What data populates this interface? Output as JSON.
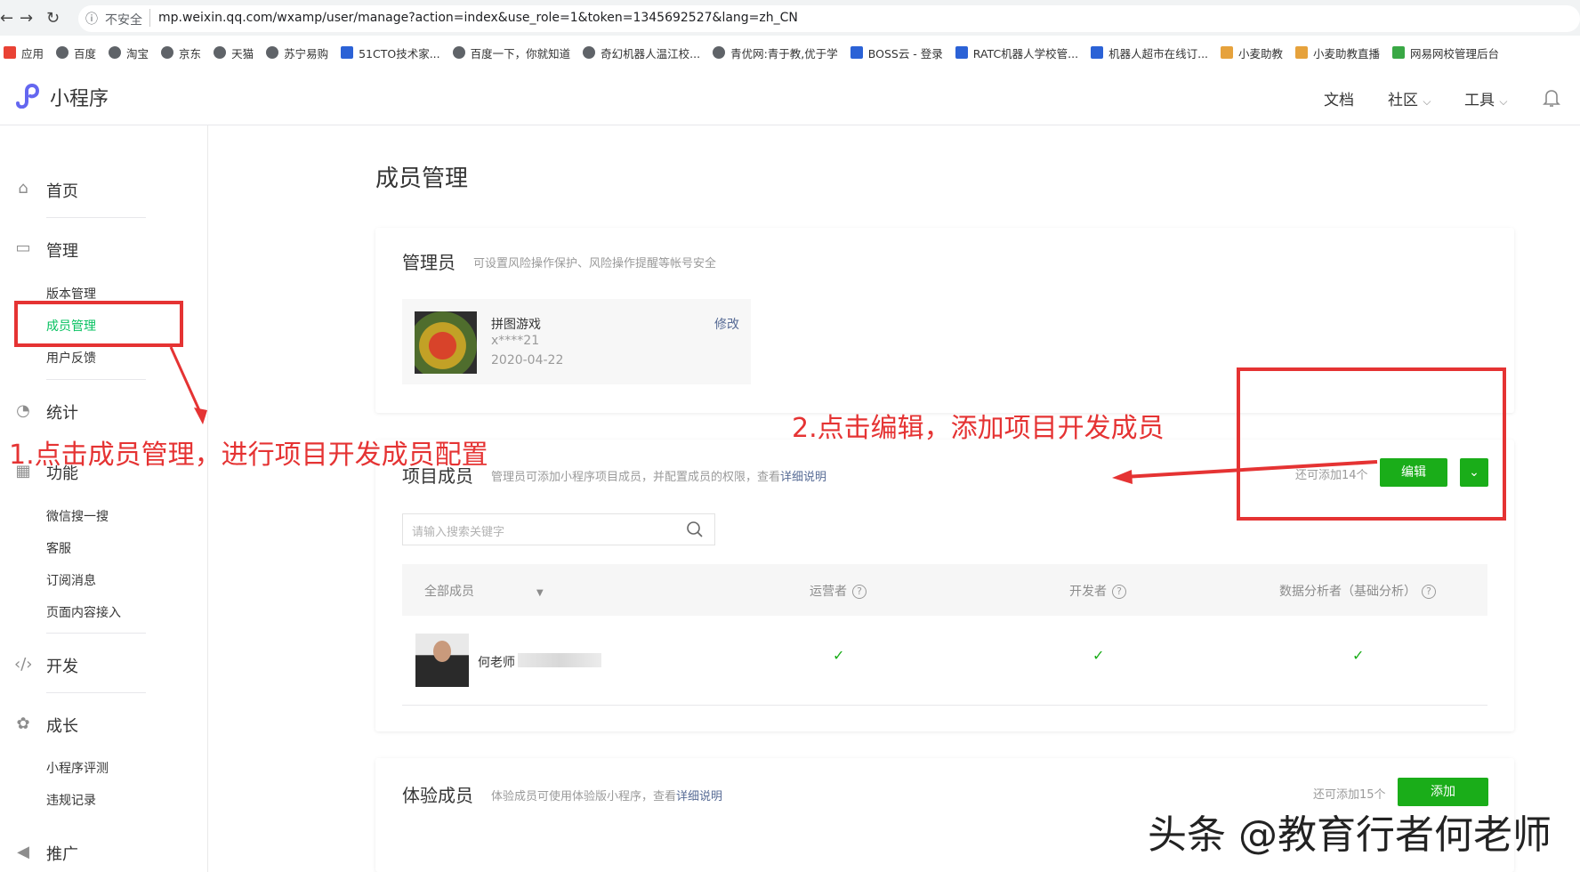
{
  "browser": {
    "back": "←",
    "forward": "→",
    "reload": "↻",
    "security": "不安全",
    "url": "mp.weixin.qq.com/wxamp/user/manage?action=index&use_role=1&token=1345692527&lang=zh_CN",
    "bookmarks": [
      "应用",
      "百度",
      "淘宝",
      "京东",
      "天猫",
      "苏宁易购",
      "51CTO技术家...",
      "百度一下，你就知道",
      "奇幻机器人温江校...",
      "青优网:青于教,优于学",
      "BOSS云 - 登录",
      "RATC机器人学校管...",
      "机器人超市在线订...",
      "小麦助教",
      "小麦助教直播",
      "网易网校管理后台"
    ]
  },
  "header": {
    "logo": "小程序",
    "nav": [
      "文档",
      "社区",
      "工具"
    ]
  },
  "sidebar": {
    "home": "首页",
    "manage": "管理",
    "manage_items": [
      "版本管理",
      "成员管理",
      "用户反馈"
    ],
    "stats": "统计",
    "features": "功能",
    "feature_items": [
      "微信搜一搜",
      "客服",
      "订阅消息",
      "页面内容接入"
    ],
    "dev": "开发",
    "growth": "成长",
    "growth_items": [
      "小程序评测",
      "违规记录"
    ],
    "promo": "推广"
  },
  "main": {
    "title": "成员管理",
    "admin": {
      "title": "管理员",
      "desc": "可设置风险操作保护、风险操作提醒等帐号安全",
      "name": "拼图游戏",
      "account": "x****21",
      "date": "2020-04-22",
      "modify": "修改"
    },
    "project": {
      "title": "项目成员",
      "desc": "管理员可添加小程序项目成员，并配置成员的权限，查看",
      "link": "详细说明",
      "remaining": "还可添加14个",
      "edit": "编辑",
      "search_placeholder": "请输入搜索关键字",
      "filter": "全部成员",
      "columns": [
        "运营者",
        "开发者",
        "数据分析者（基础分析）"
      ],
      "member": "何老师",
      "checks": [
        "✓",
        "✓",
        "✓"
      ]
    },
    "trial": {
      "title": "体验成员",
      "desc": "体验成员可使用体验版小程序，查看",
      "link": "详细说明",
      "remaining": "还可添加15个",
      "add": "添加"
    }
  },
  "annotations": {
    "step1": "1.点击成员管理，进行项目开发成员配置",
    "step2": "2.点击编辑，添加项目开发成员"
  },
  "watermark": "头条 @教育行者何老师",
  "colors": {
    "green": "#1aad19",
    "annotation_red": "#e53333",
    "link": "#576b95"
  }
}
